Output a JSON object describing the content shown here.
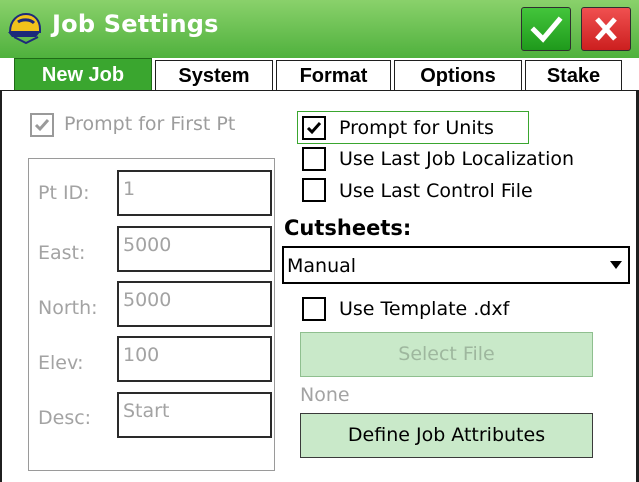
{
  "window": {
    "title": "Job Settings"
  },
  "tabs": [
    {
      "label": "New Job",
      "active": true
    },
    {
      "label": "System"
    },
    {
      "label": "Format"
    },
    {
      "label": "Options"
    },
    {
      "label": "Stake"
    }
  ],
  "left": {
    "prompt_first_pt": {
      "label": "Prompt for First Pt",
      "checked": true,
      "enabled": false
    },
    "fields": [
      {
        "label": "Pt ID:",
        "value": "1"
      },
      {
        "label": "East:",
        "value": "5000"
      },
      {
        "label": "North:",
        "value": "5000"
      },
      {
        "label": "Elev:",
        "value": "100"
      },
      {
        "label": "Desc:",
        "value": "Start"
      }
    ]
  },
  "right": {
    "prompt_units": {
      "label": "Prompt for Units",
      "checked": true
    },
    "use_last_localization": {
      "label": "Use Last Job Localization",
      "checked": false
    },
    "use_last_control": {
      "label": "Use Last Control File",
      "checked": false
    },
    "cutsheets_label": "Cutsheets:",
    "cutsheets_value": "Manual",
    "use_template": {
      "label": "Use Template .dxf",
      "checked": false
    },
    "select_file_label": "Select File",
    "file_status": "None",
    "define_attributes_label": "Define Job Attributes"
  },
  "colors": {
    "titlebar": "#4fb13d",
    "active_tab": "#3aa62f",
    "button_fill": "#c9e9c9"
  },
  "icons": [
    "app-helmet-icon",
    "ok-check-icon",
    "close-x-icon",
    "checkmark-icon",
    "dropdown-arrow-icon"
  ]
}
